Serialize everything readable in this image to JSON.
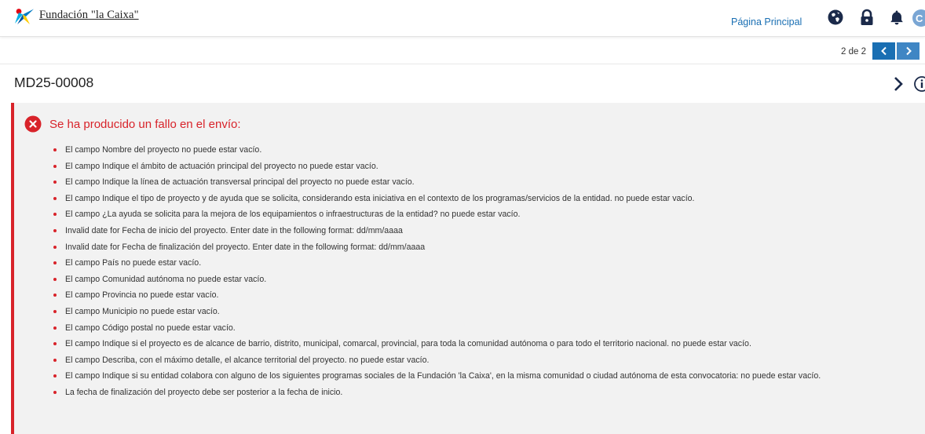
{
  "header": {
    "logo_text": "Fundación \"la Caixa\"",
    "home_link": "Página Principal",
    "icons": [
      "globe-icon",
      "lock-icon",
      "bell-icon",
      "user-avatar"
    ],
    "avatar_initial": "C"
  },
  "pager": {
    "text": "2 de 2",
    "prev_icon": "chevron-left-icon",
    "next_icon": "chevron-right-icon"
  },
  "record": {
    "id": "MD25-00008"
  },
  "alert": {
    "title": "Se ha producido un fallo en el envío:",
    "icon": "error-circle-icon",
    "errors": [
      "El campo Nombre del proyecto no puede estar vacío.",
      "El campo Indique el ámbito de actuación principal del proyecto no puede estar vacío.",
      "El campo Indique la línea de actuación transversal principal del proyecto no puede estar vacío.",
      "El campo Indique el tipo de proyecto y de ayuda que se solicita, considerando esta iniciativa en el contexto de los programas/servicios de la entidad. no puede estar vacío.",
      "El campo ¿La ayuda se solicita para la mejora de los equipamientos o infraestructuras de la entidad? no puede estar vacío.",
      "Invalid date for Fecha de inicio del proyecto. Enter date in the following format: dd/mm/aaaa",
      "Invalid date for Fecha de finalización del proyecto. Enter date in the following format: dd/mm/aaaa",
      "El campo País no puede estar vacío.",
      "El campo Comunidad autónoma no puede estar vacío.",
      "El campo Provincia no puede estar vacío.",
      "El campo Municipio no puede estar vacío.",
      "El campo Código postal no puede estar vacío.",
      "El campo Indique si el proyecto es de alcance de barrio, distrito, municipal, comarcal, provincial, para toda la comunidad autónoma o para todo el territorio nacional. no puede estar vacío.",
      "El campo Describa, con el máximo detalle, el alcance territorial del proyecto. no puede estar vacío.",
      "El campo Indique si su entidad colabora con alguno de los siguientes programas sociales de la Fundación 'la Caixa', en la misma comunidad o ciudad autónoma de esta convocatoria: no puede estar vacío.",
      "La fecha de finalización del proyecto debe ser posterior a la fecha de inicio."
    ]
  },
  "colors": {
    "brand_blue": "#1a6fb3",
    "error_red": "#d8232a",
    "alert_bg": "#f2f2f2",
    "icon_navy": "#1b2a4a"
  }
}
